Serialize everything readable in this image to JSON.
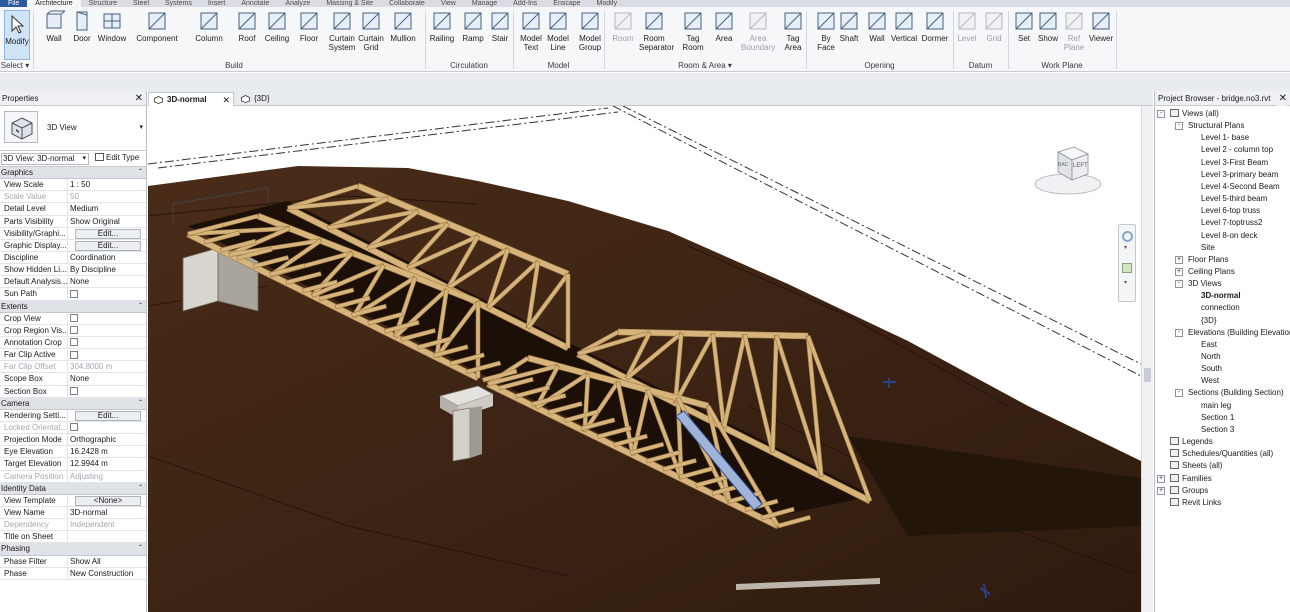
{
  "ribbon_tabs": [
    "File",
    "Architecture",
    "Structure",
    "Steel",
    "Systems",
    "Insert",
    "Annotate",
    "Analyze",
    "Massing & Site",
    "Collaborate",
    "View",
    "Manage",
    "Add-Ins",
    "Enscape",
    "Modify"
  ],
  "ribbon": {
    "buttons": [
      {
        "label": "Modify",
        "sub": "",
        "icon": "cursor-arrow-icon"
      },
      {
        "label": "Wall",
        "sub": "",
        "icon": "wall-icon"
      },
      {
        "label": "Door",
        "sub": "",
        "icon": "door-icon"
      },
      {
        "label": "Window",
        "sub": "",
        "icon": "window-icon"
      },
      {
        "label": "Component",
        "sub": "",
        "icon": "component-icon"
      },
      {
        "label": "Column",
        "sub": "",
        "icon": "column-icon"
      },
      {
        "label": "Roof",
        "sub": "",
        "icon": "roof-icon"
      },
      {
        "label": "Ceiling",
        "sub": "",
        "icon": "ceiling-icon"
      },
      {
        "label": "Floor",
        "sub": "",
        "icon": "floor-icon"
      },
      {
        "label": "Curtain",
        "sub": "System",
        "icon": "curtain-system-icon"
      },
      {
        "label": "Curtain",
        "sub": "Grid",
        "icon": "curtain-grid-icon"
      },
      {
        "label": "Mullion",
        "sub": "",
        "icon": "mullion-icon"
      },
      {
        "label": "Railing",
        "sub": "",
        "icon": "railing-icon"
      },
      {
        "label": "Ramp",
        "sub": "",
        "icon": "ramp-icon"
      },
      {
        "label": "Stair",
        "sub": "",
        "icon": "stair-icon"
      },
      {
        "label": "Model",
        "sub": "Text",
        "icon": "model-text-icon"
      },
      {
        "label": "Model",
        "sub": "Line",
        "icon": "model-line-icon"
      },
      {
        "label": "Model",
        "sub": "Group",
        "icon": "model-group-icon"
      },
      {
        "label": "Room",
        "sub": "",
        "icon": "room-icon"
      },
      {
        "label": "Room",
        "sub": "Separator",
        "icon": "room-separator-icon"
      },
      {
        "label": "Tag",
        "sub": "Room",
        "icon": "tag-room-icon"
      },
      {
        "label": "Area",
        "sub": "",
        "icon": "area-icon"
      },
      {
        "label": "Area",
        "sub": "Boundary",
        "icon": "area-boundary-icon"
      },
      {
        "label": "Tag",
        "sub": "Area",
        "icon": "tag-area-icon"
      },
      {
        "label": "By",
        "sub": "Face",
        "icon": "by-face-icon"
      },
      {
        "label": "Shaft",
        "sub": "",
        "icon": "shaft-icon"
      },
      {
        "label": "Wall",
        "sub": "",
        "icon": "wall-opening-icon"
      },
      {
        "label": "Vertical",
        "sub": "",
        "icon": "vertical-opening-icon"
      },
      {
        "label": "Dormer",
        "sub": "",
        "icon": "dormer-icon"
      },
      {
        "label": "Level",
        "sub": "",
        "icon": "level-icon"
      },
      {
        "label": "Grid",
        "sub": "",
        "icon": "grid-icon"
      },
      {
        "label": "Set",
        "sub": "",
        "icon": "set-workplane-icon"
      },
      {
        "label": "Show",
        "sub": "",
        "icon": "show-workplane-icon"
      },
      {
        "label": "Ref",
        "sub": "Plane",
        "icon": "ref-plane-icon"
      },
      {
        "label": "Viewer",
        "sub": "",
        "icon": "viewer-icon"
      }
    ],
    "groups": [
      "Select",
      "Build",
      "Circulation",
      "Model",
      "Room & Area",
      "Opening",
      "Datum",
      "Work Plane"
    ]
  },
  "properties": {
    "title": "Properties",
    "type_name": "3D View",
    "instance_selector": "3D View: 3D-normal",
    "edit_type": "Edit Type",
    "sections": [
      {
        "name": "Graphics",
        "rows": [
          {
            "k": "View Scale",
            "v": "1 : 50",
            "t": "text"
          },
          {
            "k": "Scale Value",
            "v": "50",
            "t": "dim"
          },
          {
            "k": "Detail Level",
            "v": "Medium",
            "t": "text"
          },
          {
            "k": "Parts Visibility",
            "v": "Show Original",
            "t": "text"
          },
          {
            "k": "Visibility/Graphi...",
            "v": "Edit...",
            "t": "button"
          },
          {
            "k": "Graphic Display...",
            "v": "Edit...",
            "t": "button"
          },
          {
            "k": "Discipline",
            "v": "Coordination",
            "t": "text"
          },
          {
            "k": "Show Hidden Li...",
            "v": "By Discipline",
            "t": "text"
          },
          {
            "k": "Default Analysis...",
            "v": "None",
            "t": "text"
          },
          {
            "k": "Sun Path",
            "v": "",
            "t": "check"
          }
        ]
      },
      {
        "name": "Extents",
        "rows": [
          {
            "k": "Crop View",
            "v": "",
            "t": "check"
          },
          {
            "k": "Crop Region Vis...",
            "v": "",
            "t": "check"
          },
          {
            "k": "Annotation Crop",
            "v": "",
            "t": "check"
          },
          {
            "k": "Far Clip Active",
            "v": "",
            "t": "check"
          },
          {
            "k": "Far Clip Offset",
            "v": "304.8000 m",
            "t": "dim"
          },
          {
            "k": "Scope Box",
            "v": "None",
            "t": "text"
          },
          {
            "k": "Section Box",
            "v": "",
            "t": "check"
          }
        ]
      },
      {
        "name": "Camera",
        "rows": [
          {
            "k": "Rendering Setti...",
            "v": "Edit...",
            "t": "button"
          },
          {
            "k": "Locked Orientat...",
            "v": "",
            "t": "dimcheck"
          },
          {
            "k": "Projection Mode",
            "v": "Orthographic",
            "t": "text"
          },
          {
            "k": "Eye Elevation",
            "v": "16.2428 m",
            "t": "text"
          },
          {
            "k": "Target Elevation",
            "v": "12.9944 m",
            "t": "text"
          },
          {
            "k": "Camera Position",
            "v": "Adjusting",
            "t": "dim"
          }
        ]
      },
      {
        "name": "Identity Data",
        "rows": [
          {
            "k": "View Template",
            "v": "<None>",
            "t": "button"
          },
          {
            "k": "View Name",
            "v": "3D-normal",
            "t": "text"
          },
          {
            "k": "Dependency",
            "v": "Independent",
            "t": "dim"
          },
          {
            "k": "Title on Sheet",
            "v": "",
            "t": "text"
          }
        ]
      },
      {
        "name": "Phasing",
        "rows": [
          {
            "k": "Phase Filter",
            "v": "Show All",
            "t": "text"
          },
          {
            "k": "Phase",
            "v": "New Construction",
            "t": "text"
          }
        ]
      }
    ]
  },
  "view_tabs": [
    {
      "label": "3D-normal",
      "active": true
    },
    {
      "label": "{3D}",
      "active": false
    }
  ],
  "viewcube": {
    "face_label": "LEFT",
    "side_label": "BAC"
  },
  "browser": {
    "title": "Project Browser - bridge.no3.rvt",
    "nodes": [
      {
        "label": "Views (all)",
        "level": 0,
        "toggle": "-",
        "icon": "views-icon"
      },
      {
        "label": "Structural Plans",
        "level": 1,
        "toggle": "-"
      },
      {
        "label": "Level 1- base",
        "level": 2
      },
      {
        "label": "Level 2 - column top",
        "level": 2
      },
      {
        "label": "Level 3-First Beam",
        "level": 2
      },
      {
        "label": "Level 3-primary beam",
        "level": 2
      },
      {
        "label": "Level 4-Second Beam",
        "level": 2
      },
      {
        "label": "Level 5-third beam",
        "level": 2
      },
      {
        "label": "Level 6-top truss",
        "level": 2
      },
      {
        "label": "Level 7-toptruss2",
        "level": 2
      },
      {
        "label": "Level 8-on deck",
        "level": 2
      },
      {
        "label": "Site",
        "level": 2
      },
      {
        "label": "Floor Plans",
        "level": 1,
        "toggle": "+"
      },
      {
        "label": "Ceiling Plans",
        "level": 1,
        "toggle": "+"
      },
      {
        "label": "3D Views",
        "level": 1,
        "toggle": "-"
      },
      {
        "label": "3D-normal",
        "level": 2,
        "bold": true
      },
      {
        "label": "connection",
        "level": 2
      },
      {
        "label": "{3D}",
        "level": 2
      },
      {
        "label": "Elevations (Building Elevation)",
        "level": 1,
        "toggle": "-"
      },
      {
        "label": "East",
        "level": 2
      },
      {
        "label": "North",
        "level": 2
      },
      {
        "label": "South",
        "level": 2
      },
      {
        "label": "West",
        "level": 2
      },
      {
        "label": "Sections (Building Section)",
        "level": 1,
        "toggle": "-"
      },
      {
        "label": "main leg",
        "level": 2
      },
      {
        "label": "Section 1",
        "level": 2
      },
      {
        "label": "Section 3",
        "level": 2
      },
      {
        "label": "Legends",
        "level": 0,
        "icon": "legends-icon"
      },
      {
        "label": "Schedules/Quantities (all)",
        "level": 0,
        "icon": "schedules-icon"
      },
      {
        "label": "Sheets (all)",
        "level": 0,
        "icon": "sheets-icon"
      },
      {
        "label": "Families",
        "level": 0,
        "toggle": "+",
        "icon": "families-icon"
      },
      {
        "label": "Groups",
        "level": 0,
        "toggle": "+",
        "icon": "groups-icon"
      },
      {
        "label": "Revit Links",
        "level": 0,
        "icon": "revit-links-icon"
      }
    ]
  },
  "colors": {
    "terrain": "#3b2314",
    "terrain_dark": "#2a170c",
    "timber": "#d6b47c",
    "timber_shade": "#9c7a45",
    "deck": "#1e120a",
    "accent": "#2c5aa0"
  }
}
